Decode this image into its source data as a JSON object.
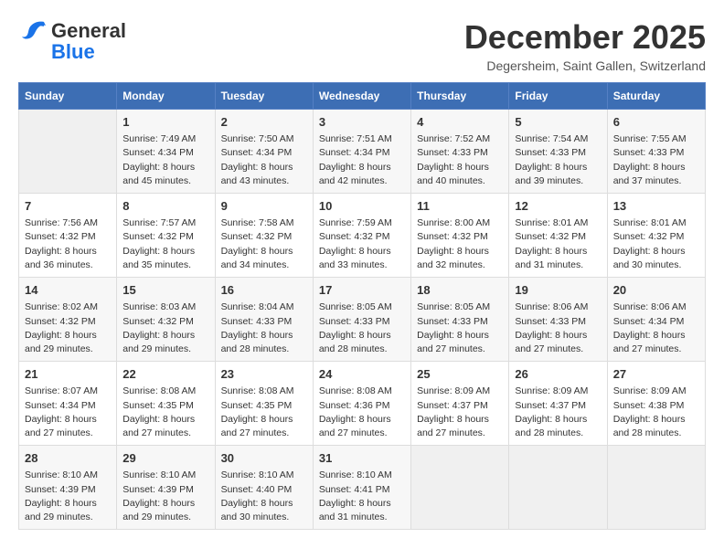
{
  "logo": {
    "general": "General",
    "blue": "Blue"
  },
  "title": "December 2025",
  "subtitle": "Degersheim, Saint Gallen, Switzerland",
  "days_of_week": [
    "Sunday",
    "Monday",
    "Tuesday",
    "Wednesday",
    "Thursday",
    "Friday",
    "Saturday"
  ],
  "weeks": [
    [
      {
        "day": "",
        "info": ""
      },
      {
        "day": "1",
        "info": "Sunrise: 7:49 AM\nSunset: 4:34 PM\nDaylight: 8 hours\nand 45 minutes."
      },
      {
        "day": "2",
        "info": "Sunrise: 7:50 AM\nSunset: 4:34 PM\nDaylight: 8 hours\nand 43 minutes."
      },
      {
        "day": "3",
        "info": "Sunrise: 7:51 AM\nSunset: 4:34 PM\nDaylight: 8 hours\nand 42 minutes."
      },
      {
        "day": "4",
        "info": "Sunrise: 7:52 AM\nSunset: 4:33 PM\nDaylight: 8 hours\nand 40 minutes."
      },
      {
        "day": "5",
        "info": "Sunrise: 7:54 AM\nSunset: 4:33 PM\nDaylight: 8 hours\nand 39 minutes."
      },
      {
        "day": "6",
        "info": "Sunrise: 7:55 AM\nSunset: 4:33 PM\nDaylight: 8 hours\nand 37 minutes."
      }
    ],
    [
      {
        "day": "7",
        "info": "Sunrise: 7:56 AM\nSunset: 4:32 PM\nDaylight: 8 hours\nand 36 minutes."
      },
      {
        "day": "8",
        "info": "Sunrise: 7:57 AM\nSunset: 4:32 PM\nDaylight: 8 hours\nand 35 minutes."
      },
      {
        "day": "9",
        "info": "Sunrise: 7:58 AM\nSunset: 4:32 PM\nDaylight: 8 hours\nand 34 minutes."
      },
      {
        "day": "10",
        "info": "Sunrise: 7:59 AM\nSunset: 4:32 PM\nDaylight: 8 hours\nand 33 minutes."
      },
      {
        "day": "11",
        "info": "Sunrise: 8:00 AM\nSunset: 4:32 PM\nDaylight: 8 hours\nand 32 minutes."
      },
      {
        "day": "12",
        "info": "Sunrise: 8:01 AM\nSunset: 4:32 PM\nDaylight: 8 hours\nand 31 minutes."
      },
      {
        "day": "13",
        "info": "Sunrise: 8:01 AM\nSunset: 4:32 PM\nDaylight: 8 hours\nand 30 minutes."
      }
    ],
    [
      {
        "day": "14",
        "info": "Sunrise: 8:02 AM\nSunset: 4:32 PM\nDaylight: 8 hours\nand 29 minutes."
      },
      {
        "day": "15",
        "info": "Sunrise: 8:03 AM\nSunset: 4:32 PM\nDaylight: 8 hours\nand 29 minutes."
      },
      {
        "day": "16",
        "info": "Sunrise: 8:04 AM\nSunset: 4:33 PM\nDaylight: 8 hours\nand 28 minutes."
      },
      {
        "day": "17",
        "info": "Sunrise: 8:05 AM\nSunset: 4:33 PM\nDaylight: 8 hours\nand 28 minutes."
      },
      {
        "day": "18",
        "info": "Sunrise: 8:05 AM\nSunset: 4:33 PM\nDaylight: 8 hours\nand 27 minutes."
      },
      {
        "day": "19",
        "info": "Sunrise: 8:06 AM\nSunset: 4:33 PM\nDaylight: 8 hours\nand 27 minutes."
      },
      {
        "day": "20",
        "info": "Sunrise: 8:06 AM\nSunset: 4:34 PM\nDaylight: 8 hours\nand 27 minutes."
      }
    ],
    [
      {
        "day": "21",
        "info": "Sunrise: 8:07 AM\nSunset: 4:34 PM\nDaylight: 8 hours\nand 27 minutes."
      },
      {
        "day": "22",
        "info": "Sunrise: 8:08 AM\nSunset: 4:35 PM\nDaylight: 8 hours\nand 27 minutes."
      },
      {
        "day": "23",
        "info": "Sunrise: 8:08 AM\nSunset: 4:35 PM\nDaylight: 8 hours\nand 27 minutes."
      },
      {
        "day": "24",
        "info": "Sunrise: 8:08 AM\nSunset: 4:36 PM\nDaylight: 8 hours\nand 27 minutes."
      },
      {
        "day": "25",
        "info": "Sunrise: 8:09 AM\nSunset: 4:37 PM\nDaylight: 8 hours\nand 27 minutes."
      },
      {
        "day": "26",
        "info": "Sunrise: 8:09 AM\nSunset: 4:37 PM\nDaylight: 8 hours\nand 28 minutes."
      },
      {
        "day": "27",
        "info": "Sunrise: 8:09 AM\nSunset: 4:38 PM\nDaylight: 8 hours\nand 28 minutes."
      }
    ],
    [
      {
        "day": "28",
        "info": "Sunrise: 8:10 AM\nSunset: 4:39 PM\nDaylight: 8 hours\nand 29 minutes."
      },
      {
        "day": "29",
        "info": "Sunrise: 8:10 AM\nSunset: 4:39 PM\nDaylight: 8 hours\nand 29 minutes."
      },
      {
        "day": "30",
        "info": "Sunrise: 8:10 AM\nSunset: 4:40 PM\nDaylight: 8 hours\nand 30 minutes."
      },
      {
        "day": "31",
        "info": "Sunrise: 8:10 AM\nSunset: 4:41 PM\nDaylight: 8 hours\nand 31 minutes."
      },
      {
        "day": "",
        "info": ""
      },
      {
        "day": "",
        "info": ""
      },
      {
        "day": "",
        "info": ""
      }
    ]
  ]
}
